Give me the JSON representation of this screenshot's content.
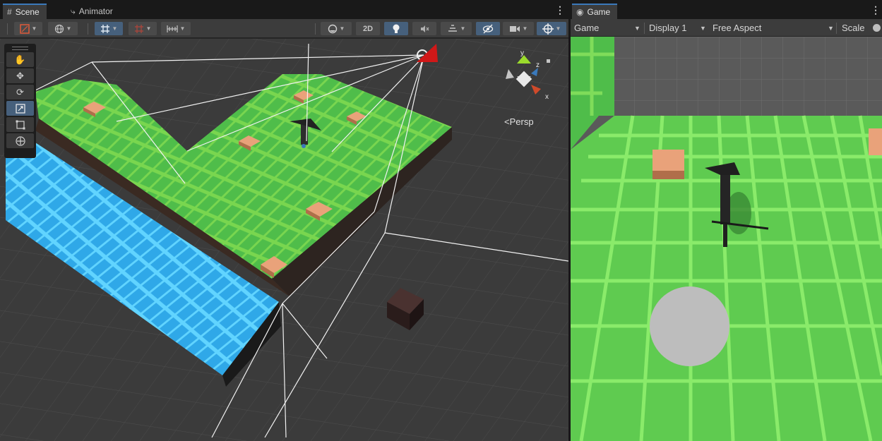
{
  "scene_window": {
    "tabs": [
      {
        "label": "Scene",
        "icon": "grid-hash-icon",
        "active": true
      },
      {
        "label": "Animator",
        "icon": "animator-icon",
        "active": false
      }
    ],
    "toolbar": {
      "toggle_2d_label": "2D"
    },
    "tools": [
      "hand-tool",
      "move-tool",
      "rotate-tool",
      "scale-tool",
      "rect-tool",
      "transform-tool"
    ],
    "gizmo": {
      "axis_y": "y",
      "axis_z": "z",
      "axis_x": "x",
      "projection_label": "Persp"
    }
  },
  "game_window": {
    "tab": {
      "label": "Game",
      "icon": "gamepad-icon"
    },
    "toolbar": {
      "game_select": "Game",
      "display_select": "Display 1",
      "aspect_select": "Free Aspect",
      "scale_label": "Scale"
    }
  },
  "colors": {
    "accent_blue": "#3a79bb",
    "selected_button": "#46607c",
    "grass": "#4fbd4a",
    "water": "#2fa8e8",
    "crate": "#e0936a"
  }
}
